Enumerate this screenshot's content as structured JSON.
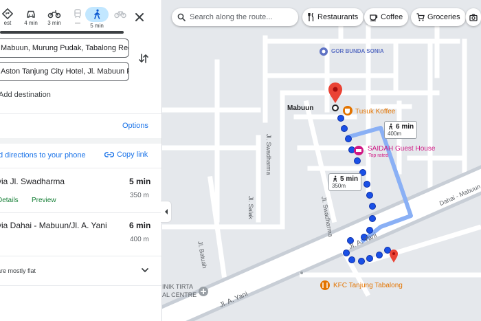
{
  "travel_modes": [
    {
      "name": "best",
      "label": "est"
    },
    {
      "name": "driving",
      "label": "4 min"
    },
    {
      "name": "two-wheeler",
      "label": "3 min"
    },
    {
      "name": "transit",
      "label": "—"
    },
    {
      "name": "walking",
      "label": "5 min"
    },
    {
      "name": "cycling",
      "label": ""
    }
  ],
  "directions": {
    "from": "Mabuun, Murung Pudak, Tabalong Regen",
    "to": "Aston Tanjung City Hotel, Jl. Mabuun Ray",
    "add_destination": "Add destination",
    "options": "Options",
    "send_to_phone": "d directions to your phone",
    "copy_link": "Copy link"
  },
  "routes": [
    {
      "title": "via Jl. Swadharma",
      "time": "5 min",
      "distance": "350 m",
      "details": "Details",
      "preview": "Preview"
    },
    {
      "title": "via Dahai - Mabuun/Jl. A. Yani",
      "time": "6 min",
      "distance": "400 m"
    }
  ],
  "elevation_note": "are mostly flat",
  "map": {
    "search_placeholder": "Search along the route...",
    "chips": [
      "Restaurants",
      "Coffee",
      "Groceries"
    ],
    "places": {
      "gor": "GOR BUNDA SONIA",
      "mabuun": "Mabuun",
      "tusuk": "Tusuk Koffee",
      "saidah": "SAIDAH Guest House",
      "saidah_sub": "Top rated",
      "kfc": "KFC Tanjung Tabalong",
      "klinik1": "INIK TIRTA",
      "klinik2": "AL CENTRE"
    },
    "streets": {
      "swadharma1": "Jl. Swadharma",
      "swadharma2": "Jl. Swadharma",
      "salak": "Jl. Salak",
      "batuah": "Jl. Batuah",
      "ayani": "Jl. A. Yani",
      "ayani2": "Jl. A. Yani",
      "dahai": "Dahai - Mabuun"
    },
    "callouts": [
      {
        "time": "6 min",
        "distance": "400m"
      },
      {
        "time": "5 min",
        "distance": "350m"
      }
    ]
  },
  "colors": {
    "accent": "#1a73e8",
    "route_primary": "#1a50e6",
    "route_alt": "#8ab0f5",
    "active_mode": "#c2e7ff",
    "pin": "#ea4335",
    "place_orange": "#e37400",
    "place_pink": "#d01884"
  }
}
